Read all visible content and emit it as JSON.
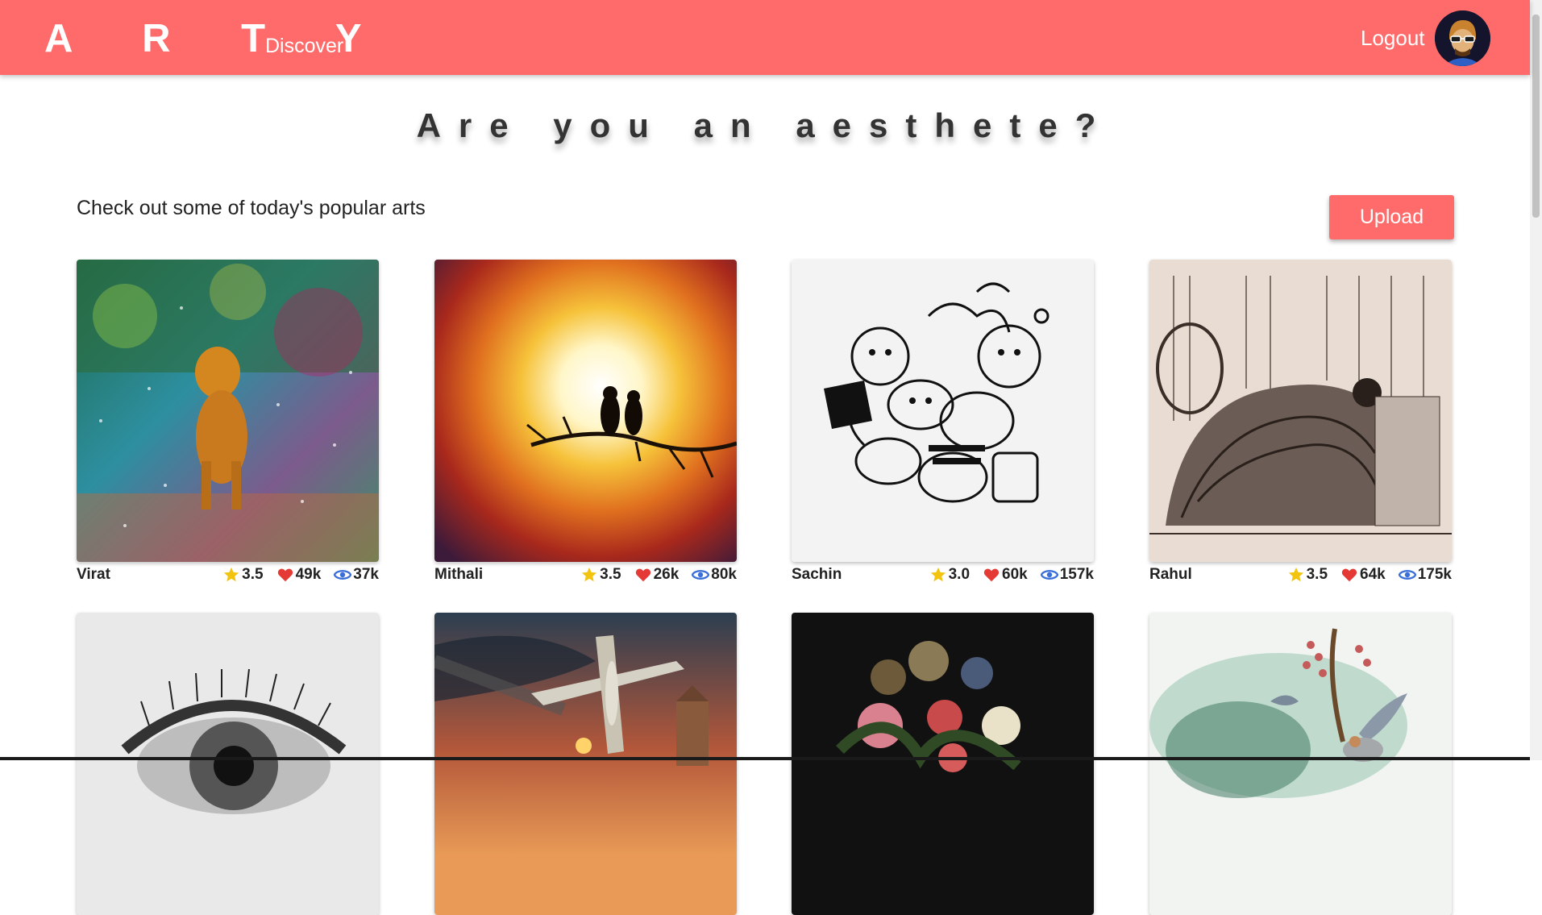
{
  "brand": "A R T Y",
  "nav": {
    "discover": "Discover",
    "logout": "Logout"
  },
  "headline": "Are you an aesthete?",
  "subtitle": "Check out some of today's popular arts",
  "upload_label": "Upload",
  "colors": {
    "accent": "#ff6b6b",
    "star": "#f2c40f",
    "heart": "#e53935",
    "eye": "#3b6fd8"
  },
  "icons": {
    "rating": "star-icon",
    "likes": "heart-icon",
    "views": "eye-icon"
  },
  "artworks": [
    {
      "artist": "Virat",
      "rating": "3.5",
      "likes": "49k",
      "views": "37k",
      "image": "impressionist dog painting"
    },
    {
      "artist": "Mithali",
      "rating": "3.5",
      "likes": "26k",
      "views": "80k",
      "image": "birds on branch against sunburst"
    },
    {
      "artist": "Sachin",
      "rating": "3.0",
      "likes": "60k",
      "views": "157k",
      "image": "doodle monsters ink drawing"
    },
    {
      "artist": "Rahul",
      "rating": "3.5",
      "likes": "64k",
      "views": "175k",
      "image": "victorian etching woman in dress"
    },
    {
      "image": "pencil eye drawing"
    },
    {
      "image": "airplane dogfight painting"
    },
    {
      "image": "dark still life flowers"
    },
    {
      "image": "watercolor birds on branch"
    }
  ]
}
